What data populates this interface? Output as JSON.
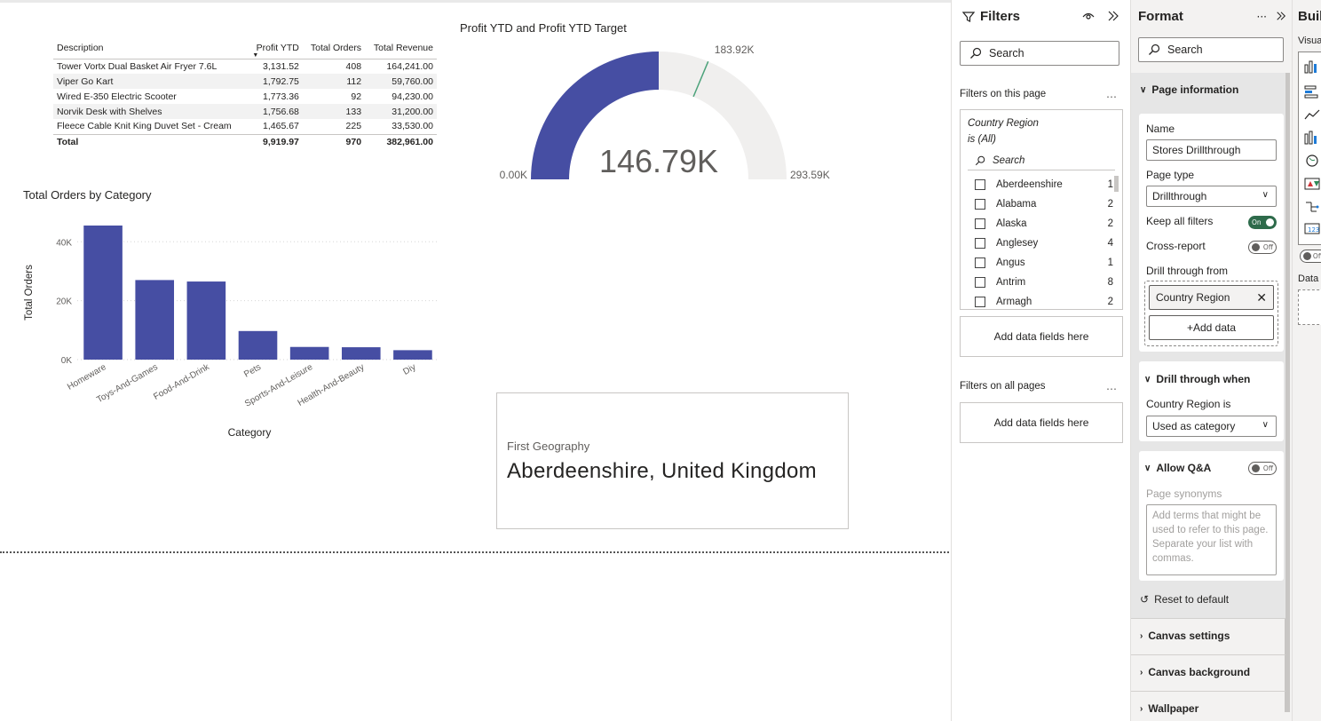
{
  "table": {
    "headers": [
      "Description",
      "Profit YTD",
      "Total Orders",
      "Total Revenue"
    ],
    "rows": [
      [
        "Tower Vortx Dual Basket Air Fryer 7.6L",
        "3,131.52",
        "408",
        "164,241.00"
      ],
      [
        "Viper Go Kart",
        "1,792.75",
        "112",
        "59,760.00"
      ],
      [
        "Wired E-350 Electric Scooter",
        "1,773.36",
        "92",
        "94,230.00"
      ],
      [
        "Norvik Desk with Shelves",
        "1,756.68",
        "133",
        "31,200.00"
      ],
      [
        "Fleece Cable Knit King Duvet Set - Cream",
        "1,465.67",
        "225",
        "33,530.00"
      ]
    ],
    "total": [
      "Total",
      "9,919.97",
      "970",
      "382,961.00"
    ]
  },
  "chart_data": [
    {
      "type": "bar",
      "title": "Total Orders by Category",
      "xlabel": "Category",
      "ylabel": "Total Orders",
      "categories": [
        "Homeware",
        "Toys-And-Games",
        "Food-And-Drink",
        "Pets",
        "Sports-And-Leisure",
        "Health-And-Beauty",
        "Diy"
      ],
      "values": [
        45500,
        27000,
        26500,
        9700,
        4300,
        4200,
        3200
      ],
      "ylim": [
        0,
        45500
      ],
      "yticks": [
        0,
        20000,
        40000
      ],
      "ytick_labels": [
        "0K",
        "20K",
        "40K"
      ],
      "grid": true,
      "color": "#464ea3"
    },
    {
      "type": "gauge",
      "title": "Profit YTD and Profit YTD Target",
      "value": 146790,
      "target": 183920,
      "min": 0,
      "max": 293590,
      "value_label": "146.79K",
      "target_label": "183.92K",
      "min_label": "0.00K",
      "max_label": "293.59K",
      "color": "#464ea3",
      "track_color": "#f0efee",
      "target_color": "#4ba27a"
    }
  ],
  "card": {
    "label": "First Geography",
    "value": "Aberdeenshire, United Kingdom"
  },
  "filters": {
    "title": "Filters",
    "search_placeholder": "Search",
    "on_this_page": "Filters on this page",
    "field_name": "Country Region",
    "field_state": "is (All)",
    "field_search": "Search",
    "items": [
      {
        "name": "Aberdeenshire",
        "count": "1"
      },
      {
        "name": "Alabama",
        "count": "2"
      },
      {
        "name": "Alaska",
        "count": "2"
      },
      {
        "name": "Anglesey",
        "count": "4"
      },
      {
        "name": "Angus",
        "count": "1"
      },
      {
        "name": "Antrim",
        "count": "8"
      },
      {
        "name": "Armagh",
        "count": "2"
      }
    ],
    "add_fields": "Add data fields here",
    "on_all_pages": "Filters on all pages",
    "add_fields_all": "Add data fields here"
  },
  "format": {
    "title": "Format",
    "search_placeholder": "Search",
    "page_information": "Page information",
    "name_label": "Name",
    "name_value": "Stores Drillthrough",
    "page_type_label": "Page type",
    "page_type_value": "Drillthrough",
    "keep_all_filters": "Keep all filters",
    "keep_all_filters_state": "On",
    "cross_report": "Cross-report",
    "cross_report_state": "Off",
    "drill_through_from": "Drill through from",
    "drill_field": "Country Region",
    "add_data": "+Add data",
    "drill_through_when": "Drill through when",
    "country_region_is": "Country Region is",
    "used_as": "Used as category",
    "allow_qa": "Allow Q&A",
    "allow_qa_state": "Off",
    "page_synonyms": "Page synonyms",
    "synonyms_placeholder": "Add terms that might be used to refer to this page. Separate your list with commas.",
    "reset": "Reset to default",
    "canvas_settings": "Canvas settings",
    "canvas_background": "Canvas background",
    "wallpaper": "Wallpaper"
  },
  "build": {
    "title": "Build",
    "visuals_label": "Visualizations",
    "off_label": "Off",
    "data_label": "Data"
  }
}
